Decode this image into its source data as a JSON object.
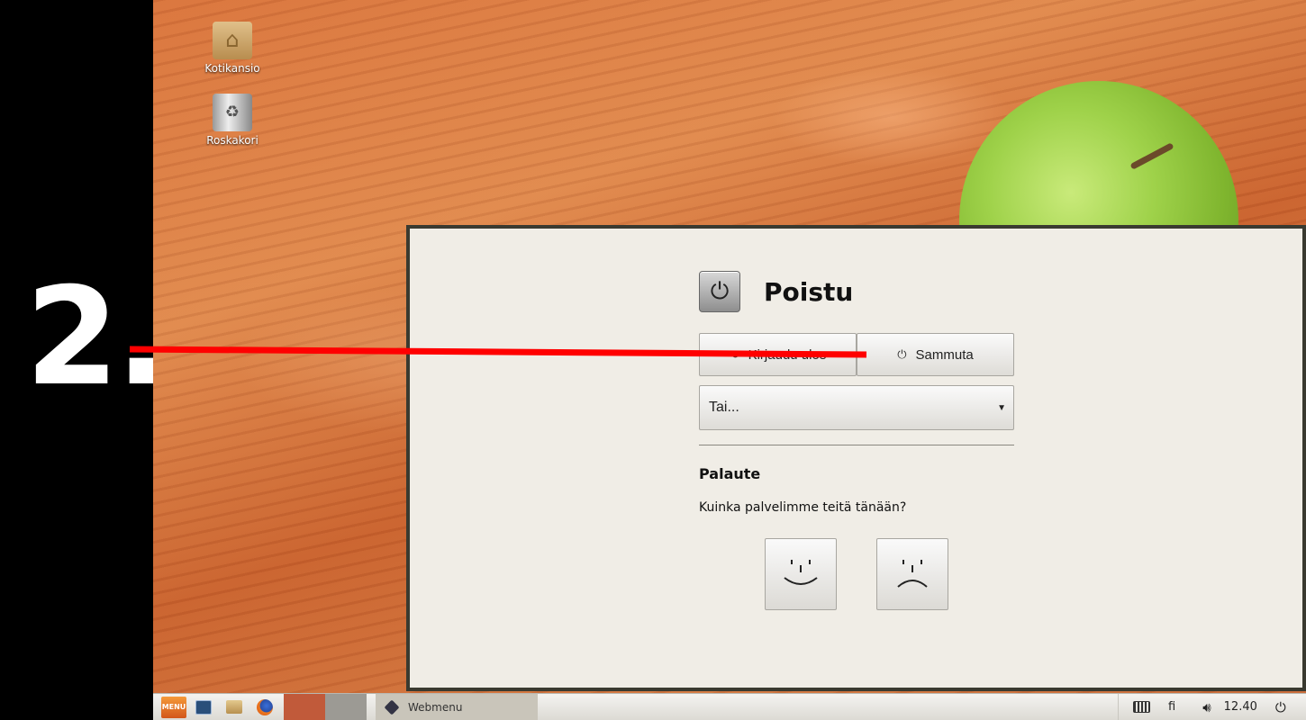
{
  "annotation": {
    "step_number": "2."
  },
  "desktop": {
    "icons": [
      {
        "label": "Kotikansio",
        "icon": "home-folder-icon"
      },
      {
        "label": "Roskakori",
        "icon": "trash-icon"
      }
    ]
  },
  "dialog": {
    "title": "Poistu",
    "logout_label": "Kirjaudu ulos",
    "shutdown_label": "Sammuta",
    "more_select": "Tai...",
    "feedback_heading": "Palaute",
    "feedback_question": "Kuinka palvelimme teitä tänään?"
  },
  "taskbar": {
    "menu_label": "MENU",
    "task_label": "Webmenu",
    "keyboard_layout": "fi",
    "clock": "12.40"
  },
  "colors": {
    "dialog_bg": "#f0ede6",
    "annotation_line": "#ff0000",
    "dialog_border": "#3a3a30"
  }
}
